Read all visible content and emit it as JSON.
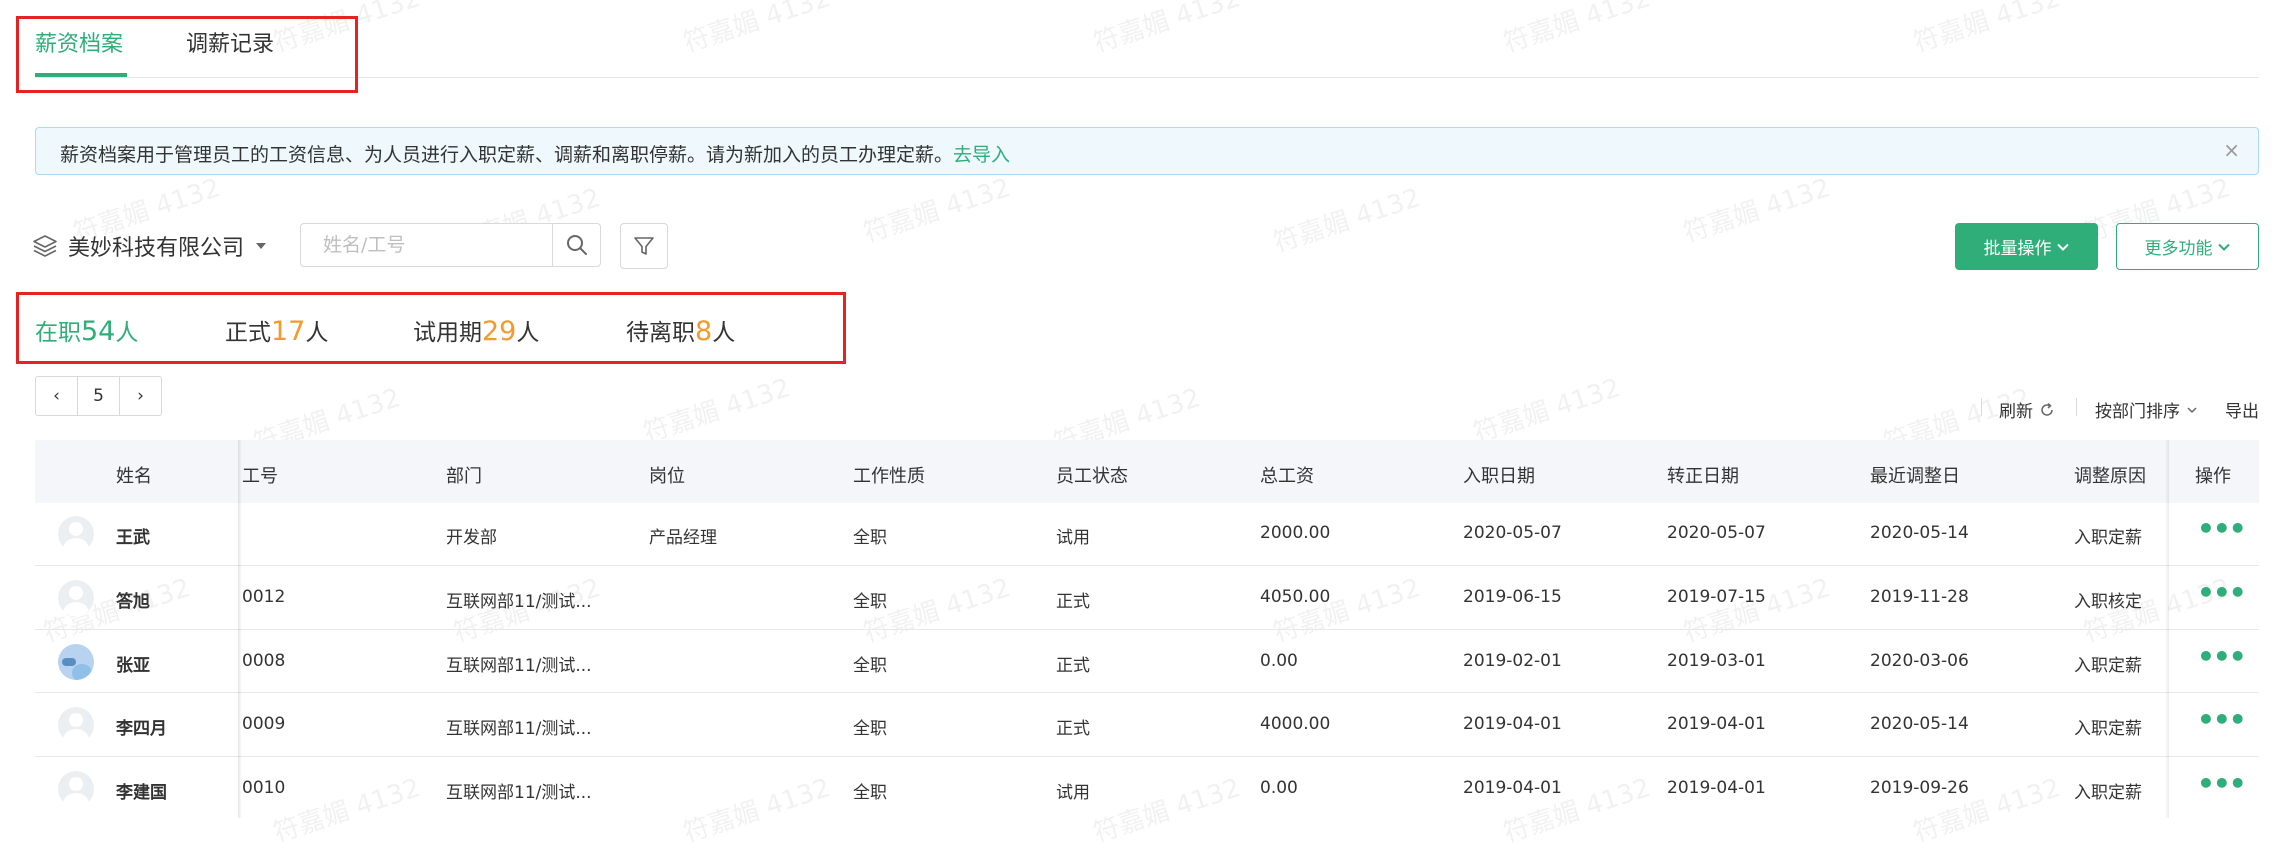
{
  "tabs": [
    {
      "label": "薪资档案",
      "active": true
    },
    {
      "label": "调薪记录",
      "active": false
    }
  ],
  "notice": {
    "text": "薪资档案用于管理员工的工资信息、为人员进行入职定薪、调薪和离职停薪。请为新加入的员工办理定薪。",
    "link": "去导入",
    "close": "×"
  },
  "toolbar": {
    "company": "美妙科技有限公司",
    "search_placeholder": "姓名/工号",
    "batch_label": "批量操作",
    "more_label": "更多功能"
  },
  "stats": [
    {
      "label": "在职",
      "count": "54",
      "unit": "人"
    },
    {
      "label": "正式",
      "count": "17",
      "unit": "人"
    },
    {
      "label": "试用期",
      "count": "29",
      "unit": "人"
    },
    {
      "label": "待离职",
      "count": "8",
      "unit": "人"
    }
  ],
  "pager": {
    "prev": "‹",
    "page": "5",
    "next": "›"
  },
  "tools": {
    "refresh": "刷新",
    "sort": "按部门排序",
    "export": "导出"
  },
  "table": {
    "columns": [
      "姓名",
      "工号",
      "部门",
      "岗位",
      "工作性质",
      "员工状态",
      "总工资",
      "入职日期",
      "转正日期",
      "最近调整日",
      "调整原因",
      "操作"
    ],
    "rows": [
      {
        "name": "王武",
        "id": "",
        "dept": "开发部",
        "post": "产品经理",
        "type": "全职",
        "status": "试用",
        "salary": "2000.00",
        "join": "2020-05-07",
        "regular": "2020-05-07",
        "adjust": "2020-05-14",
        "reason": "入职定薪",
        "avatar": "default"
      },
      {
        "name": "答旭",
        "id": "0012",
        "dept": "互联网部11/测试...",
        "post": "",
        "type": "全职",
        "status": "正式",
        "salary": "4050.00",
        "join": "2019-06-15",
        "regular": "2019-07-15",
        "adjust": "2019-11-28",
        "reason": "入职核定",
        "avatar": "default"
      },
      {
        "name": "张亚",
        "id": "0008",
        "dept": "互联网部11/测试...",
        "post": "",
        "type": "全职",
        "status": "正式",
        "salary": "0.00",
        "join": "2019-02-01",
        "regular": "2019-03-01",
        "adjust": "2020-03-06",
        "reason": "入职定薪",
        "avatar": "photo"
      },
      {
        "name": "李四月",
        "id": "0009",
        "dept": "互联网部11/测试...",
        "post": "",
        "type": "全职",
        "status": "正式",
        "salary": "4000.00",
        "join": "2019-04-01",
        "regular": "2019-04-01",
        "adjust": "2020-05-14",
        "reason": "入职定薪",
        "avatar": "default"
      },
      {
        "name": "李建国",
        "id": "0010",
        "dept": "互联网部11/测试...",
        "post": "",
        "type": "全职",
        "status": "试用",
        "salary": "0.00",
        "join": "2019-04-01",
        "regular": "2019-04-01",
        "adjust": "2019-09-26",
        "reason": "入职定薪",
        "avatar": "default"
      }
    ],
    "action_glyph": "•••"
  },
  "watermark": "符嘉媚 4132",
  "colors": {
    "accent": "#2fae79",
    "count": "#f39a2c",
    "highlight": "#e62222",
    "notice_bg": "#eef8fd"
  }
}
